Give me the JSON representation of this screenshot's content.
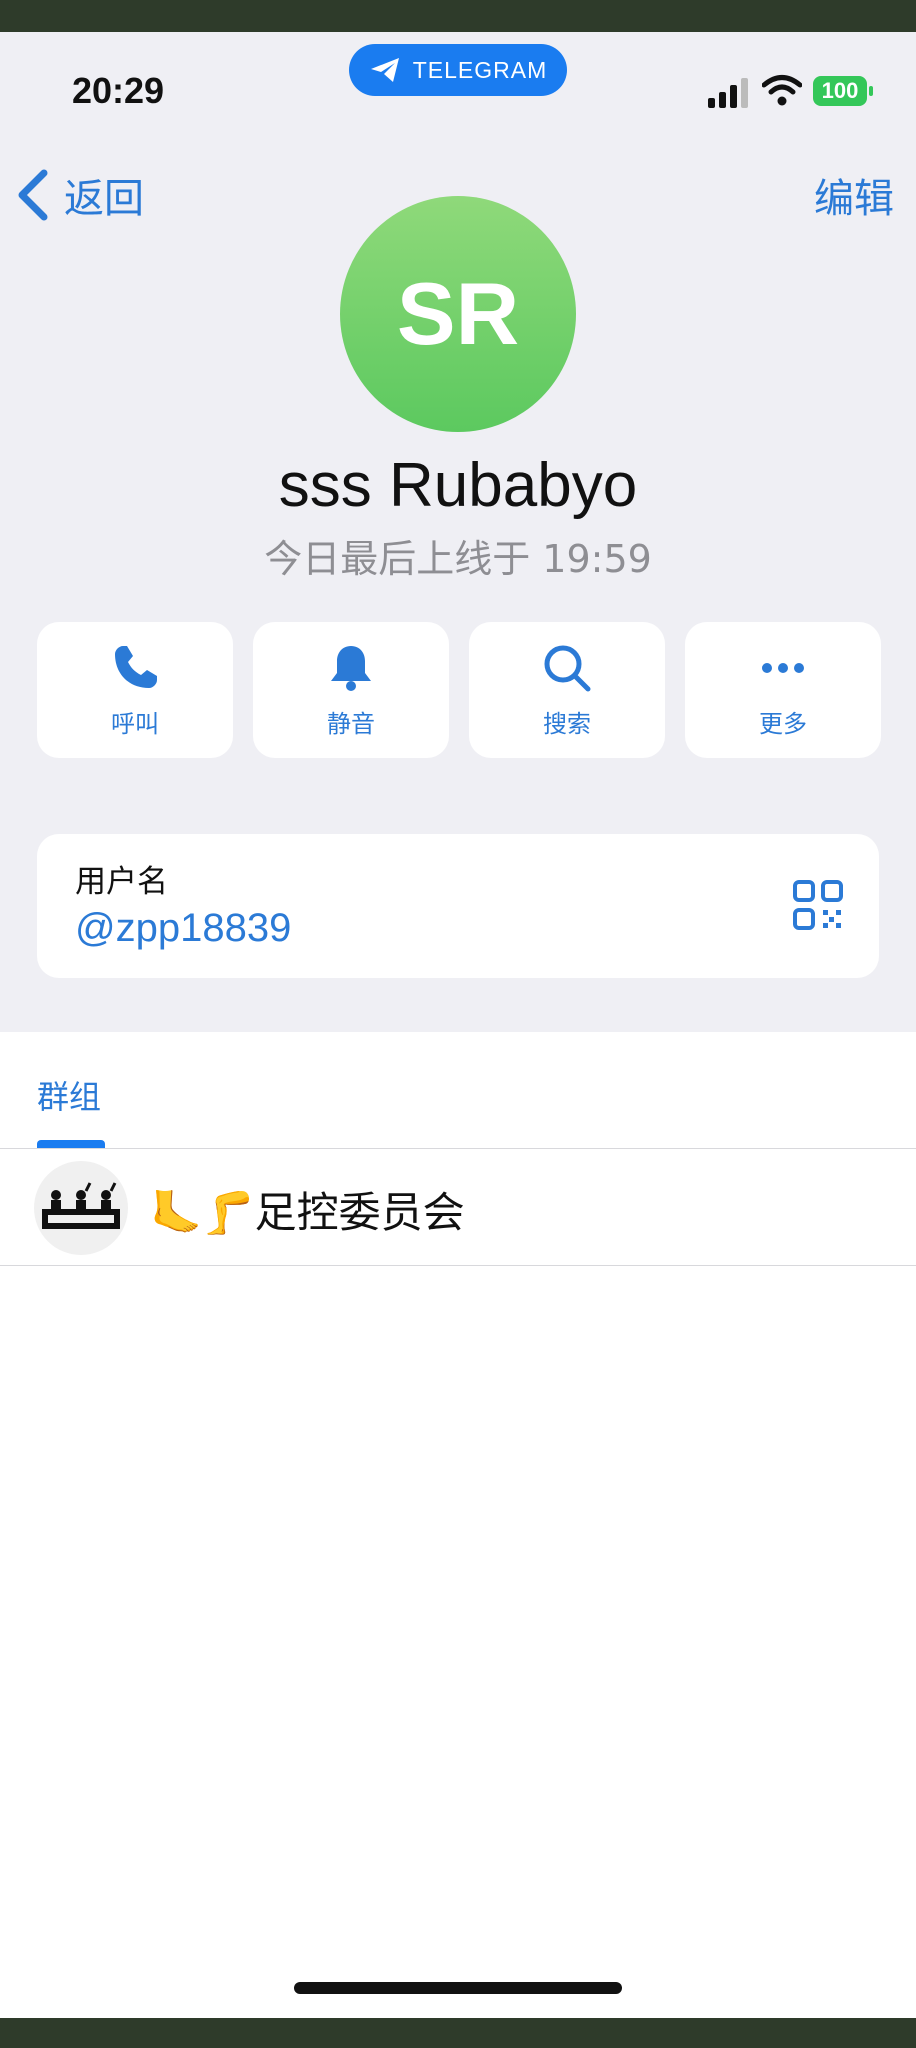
{
  "status_bar": {
    "time": "20:29",
    "app_pill": "TELEGRAM",
    "battery": "100"
  },
  "nav": {
    "back_label": "返回",
    "edit_label": "编辑"
  },
  "profile": {
    "initials": "SR",
    "name": "sss Rubabyo",
    "last_seen": "今日最后上线于 19:59"
  },
  "actions": [
    {
      "label": "呼叫",
      "icon": "phone-icon"
    },
    {
      "label": "静音",
      "icon": "bell-icon"
    },
    {
      "label": "搜索",
      "icon": "search-icon"
    },
    {
      "label": "更多",
      "icon": "more-icon"
    }
  ],
  "username": {
    "label": "用户名",
    "value": "@zpp18839"
  },
  "tabs": {
    "groups": "群组"
  },
  "groups": [
    {
      "name": "🦶🦵足控委员会"
    }
  ],
  "colors": {
    "accent": "#2b7ad6",
    "pill": "#1a7cf0",
    "avatar_green": "#5cc95f",
    "background": "#efeff4"
  }
}
